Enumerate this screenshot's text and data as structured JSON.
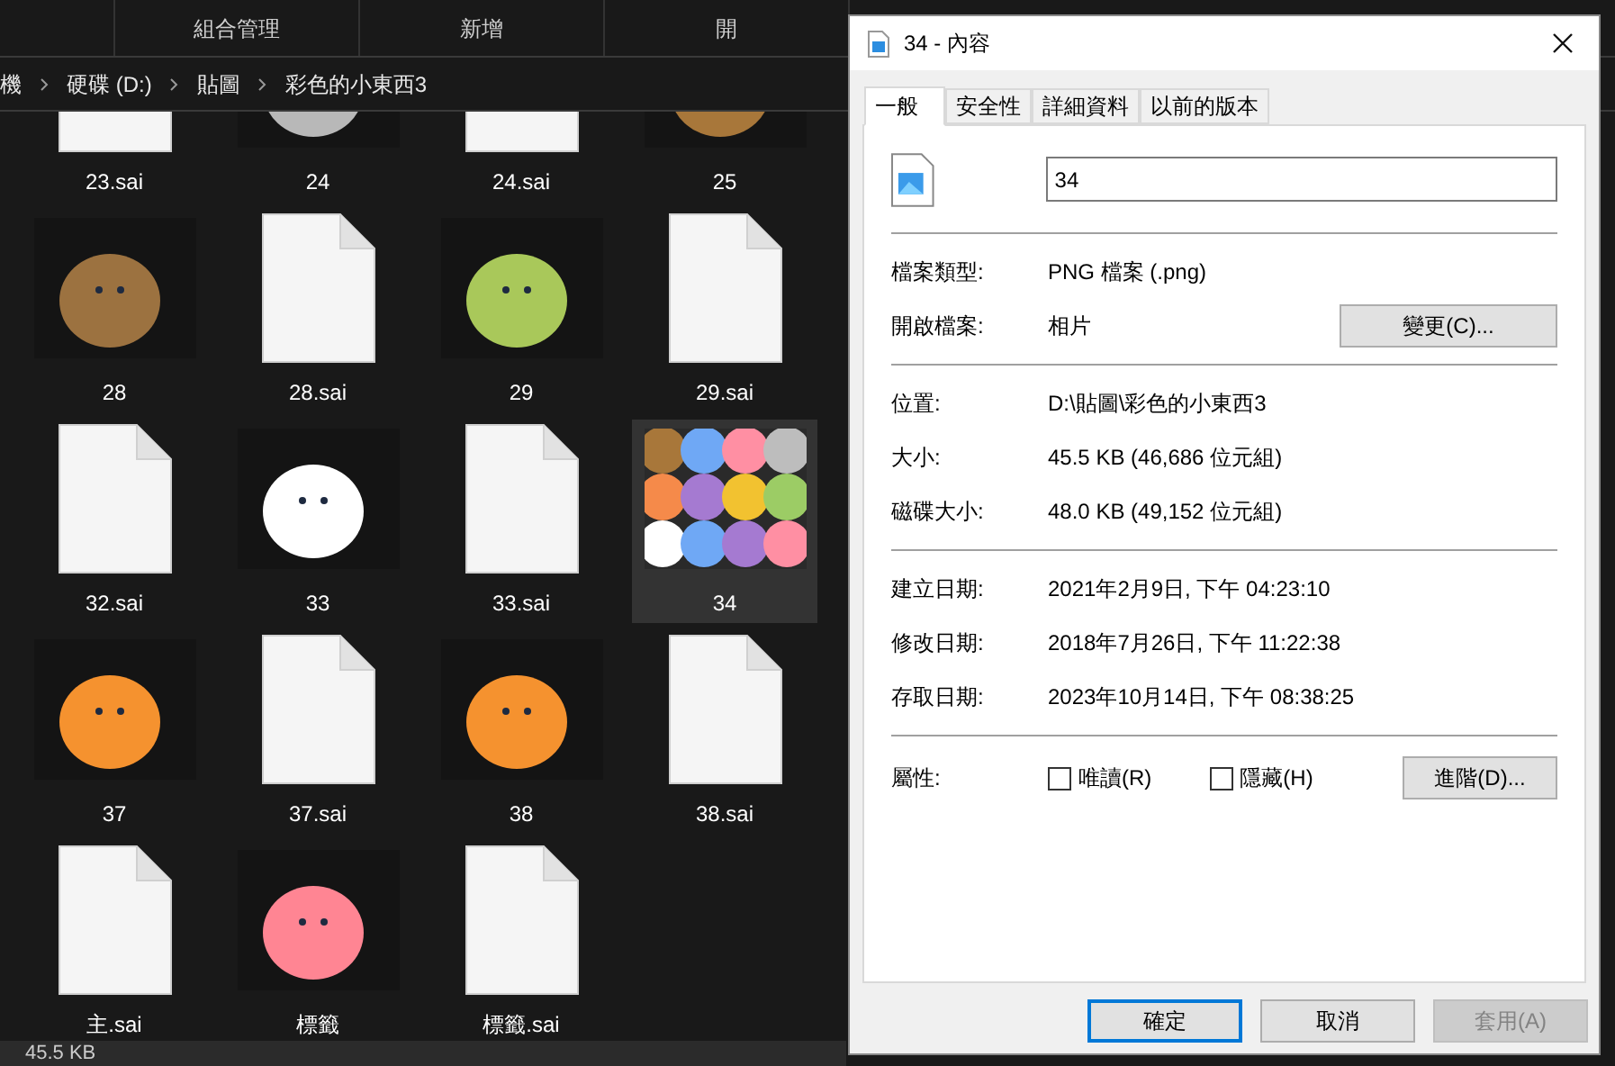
{
  "explorer": {
    "ribbon": [
      "組合管理",
      "新增",
      "開"
    ],
    "breadcrumb": [
      "機",
      "硬碟 (D:)",
      "貼圖",
      "彩色的小東西3"
    ],
    "files": [
      {
        "name": "23.sai",
        "kind": "doc",
        "selected": false
      },
      {
        "name": "24",
        "kind": "image",
        "color": "#b8b8b8",
        "selected": false
      },
      {
        "name": "24.sai",
        "kind": "doc",
        "selected": false
      },
      {
        "name": "25",
        "kind": "image",
        "color": "#a8773a",
        "selected": false
      },
      {
        "name": "28",
        "kind": "image",
        "color": "#9c7240",
        "selected": false
      },
      {
        "name": "28.sai",
        "kind": "doc",
        "selected": false
      },
      {
        "name": "29",
        "kind": "image",
        "color": "#a9c85a",
        "selected": false
      },
      {
        "name": "29.sai",
        "kind": "doc",
        "selected": false
      },
      {
        "name": "32.sai",
        "kind": "doc",
        "selected": false
      },
      {
        "name": "33",
        "kind": "image",
        "color": "#ffffff",
        "selected": false
      },
      {
        "name": "33.sai",
        "kind": "doc",
        "selected": false
      },
      {
        "name": "34",
        "kind": "collage",
        "selected": true
      },
      {
        "name": "37",
        "kind": "image",
        "color": "#f5922f",
        "selected": false
      },
      {
        "name": "37.sai",
        "kind": "doc",
        "selected": false
      },
      {
        "name": "38",
        "kind": "image",
        "color": "#f5922f",
        "selected": false
      },
      {
        "name": "38.sai",
        "kind": "doc",
        "selected": false
      },
      {
        "name": "主.sai",
        "kind": "doc",
        "selected": false
      },
      {
        "name": "標籤",
        "kind": "image",
        "color": "#ff8593",
        "selected": false
      },
      {
        "name": "標籤.sai",
        "kind": "doc",
        "selected": false
      }
    ],
    "status": "45.5 KB"
  },
  "dialog": {
    "title": "34 - 內容",
    "tabs": [
      {
        "label": "一般",
        "selected": true
      },
      {
        "label": "安全性",
        "selected": false
      },
      {
        "label": "詳細資料",
        "selected": false
      },
      {
        "label": "以前的版本",
        "selected": false
      }
    ],
    "file_name": "34",
    "groups": [
      [
        {
          "label": "檔案類型:",
          "value": "PNG 檔案 (.png)"
        },
        {
          "label": "開啟檔案:",
          "value": "相片",
          "button": "變更(C)..."
        }
      ],
      [
        {
          "label": "位置:",
          "value": "D:\\貼圖\\彩色的小東西3"
        },
        {
          "label": "大小:",
          "value": "45.5 KB (46,686 位元組)"
        },
        {
          "label": "磁碟大小:",
          "value": "48.0 KB (49,152 位元組)"
        }
      ],
      [
        {
          "label": "建立日期:",
          "value": "2021年2月9日, 下午 04:23:10"
        },
        {
          "label": "修改日期:",
          "value": "2018年7月26日, 下午 11:22:38"
        },
        {
          "label": "存取日期:",
          "value": "2023年10月14日, 下午 08:38:25"
        }
      ]
    ],
    "attributes": {
      "label": "屬性:",
      "checks": [
        {
          "label": "唯讀(R)",
          "checked": false
        },
        {
          "label": "隱藏(H)",
          "checked": false
        }
      ],
      "button": "進階(D)..."
    },
    "buttons": [
      {
        "label": "確定",
        "default": true,
        "disabled": false
      },
      {
        "label": "取消",
        "default": false,
        "disabled": false
      },
      {
        "label": "套用(A)",
        "default": false,
        "disabled": true
      }
    ]
  }
}
